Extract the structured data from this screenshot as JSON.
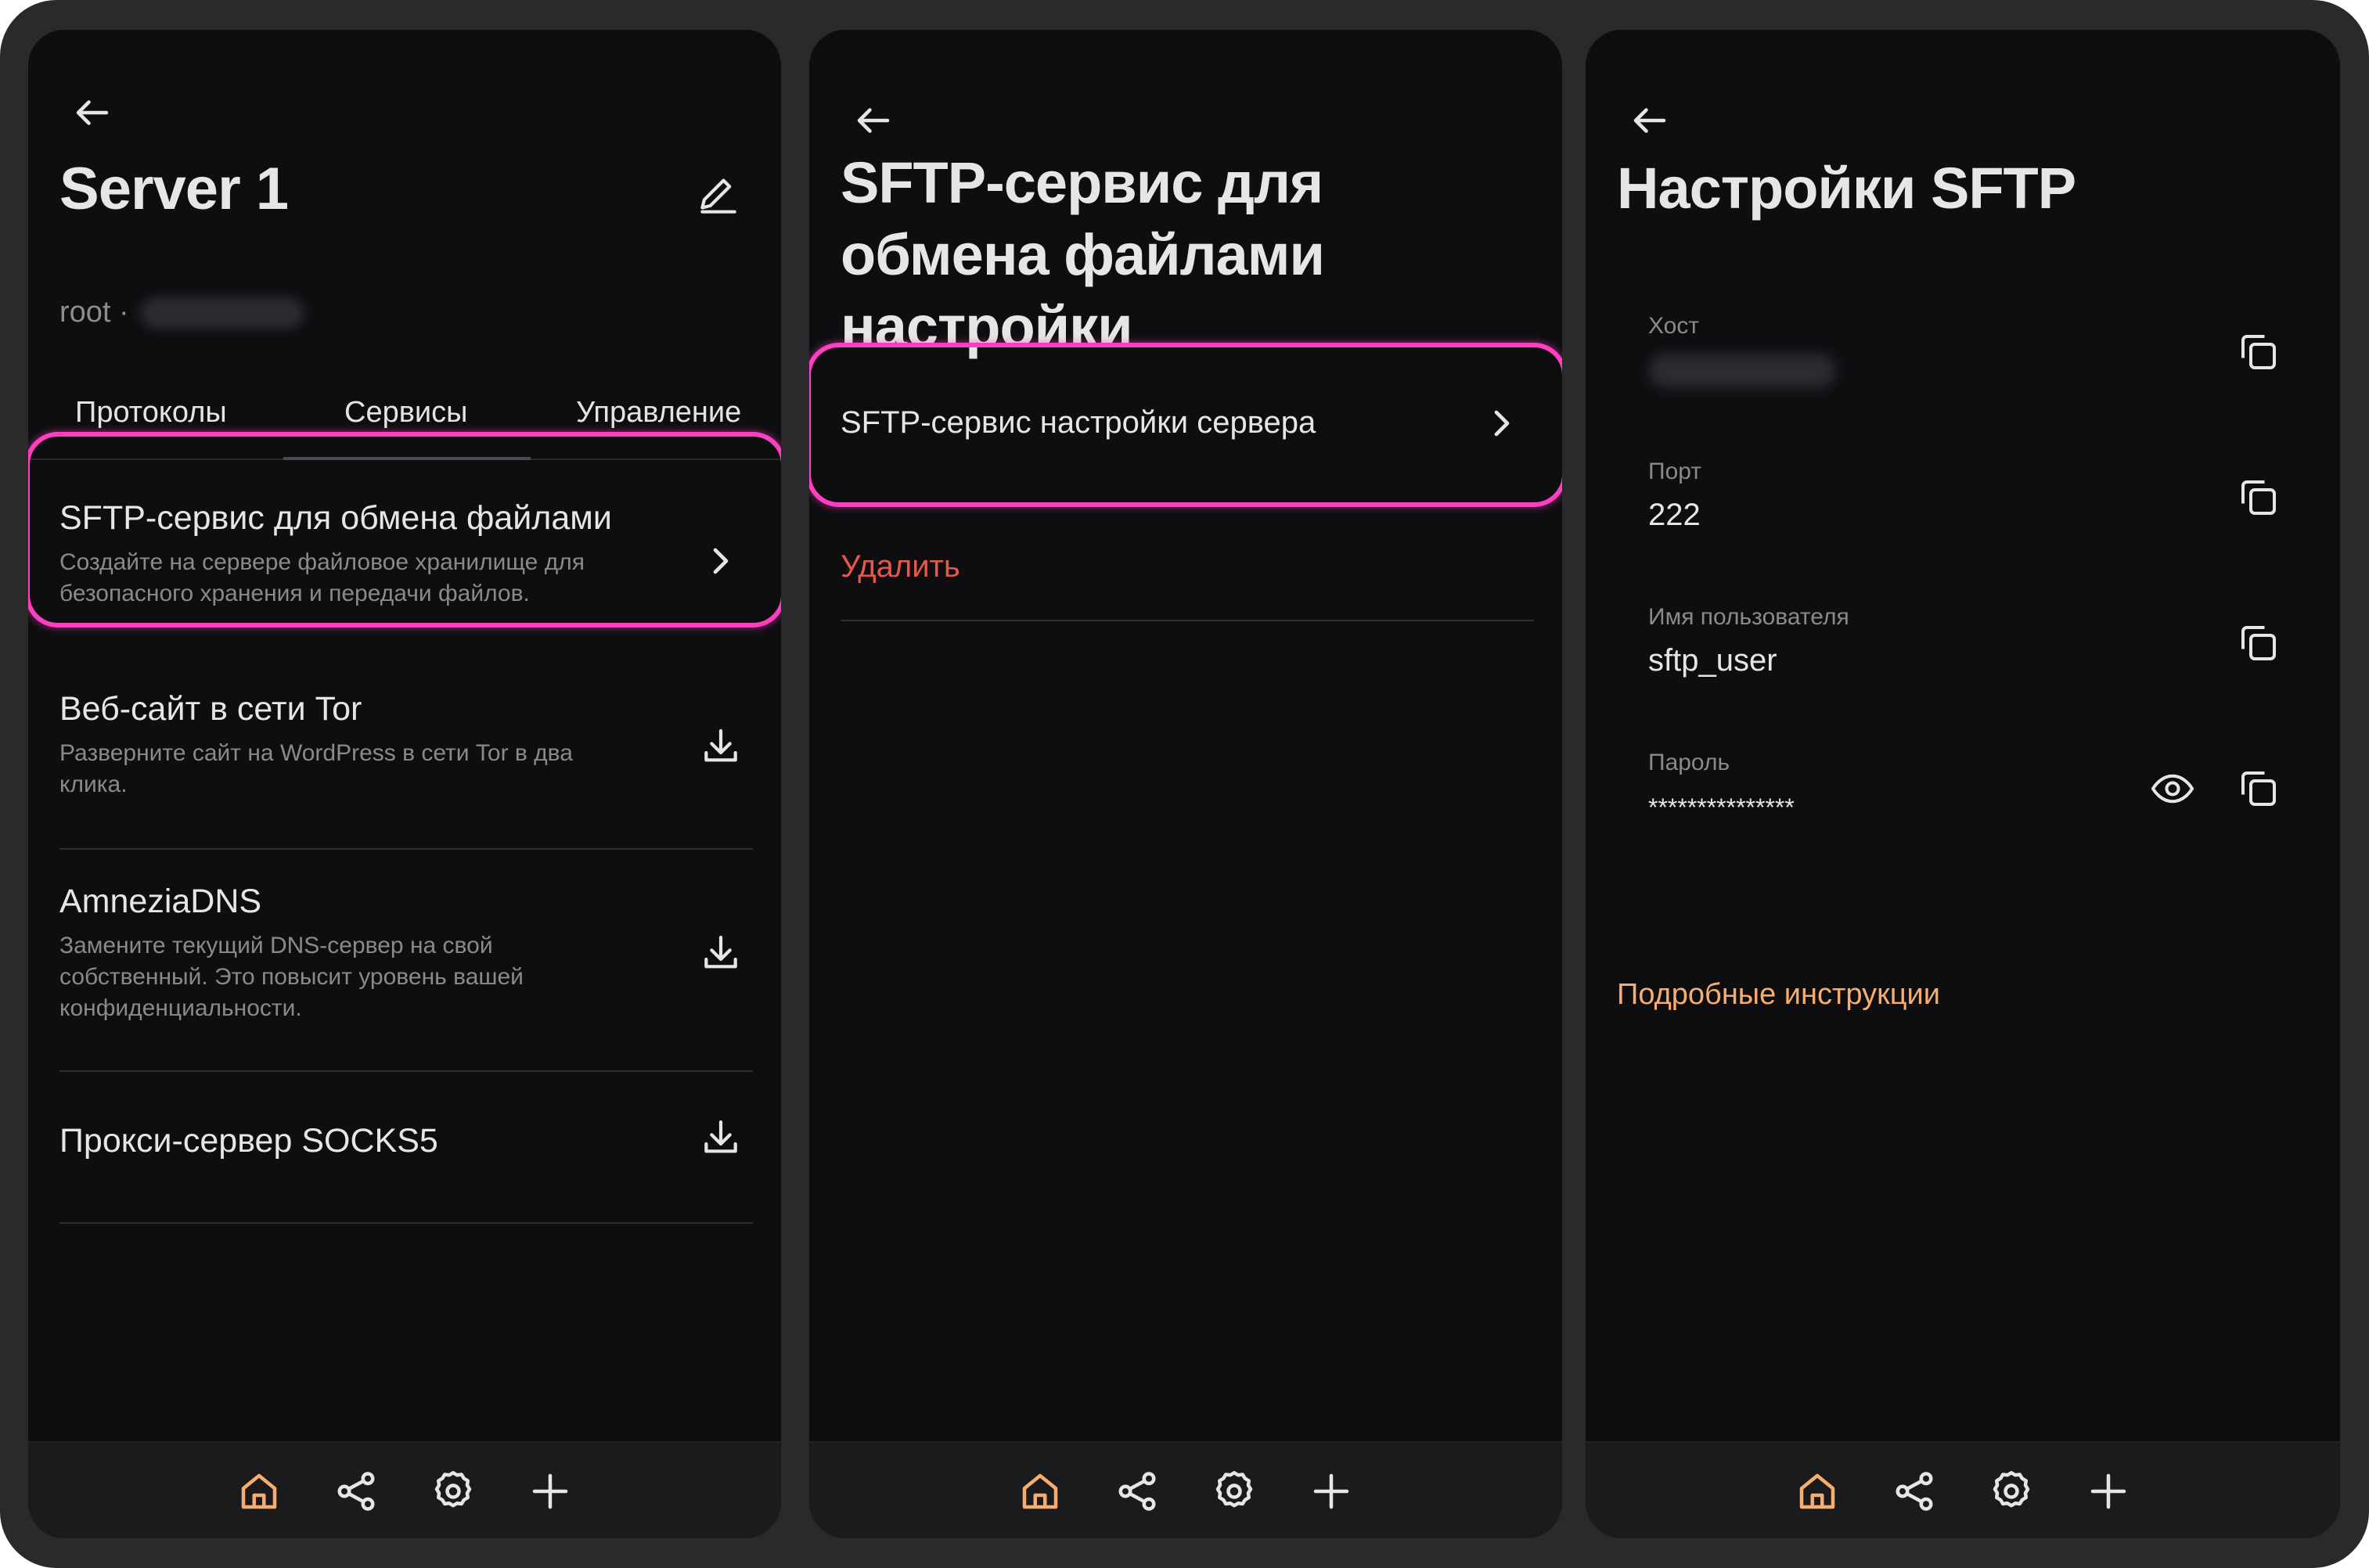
{
  "colors": {
    "accent": "#F7AD6F",
    "highlight": "#FF3FC2",
    "danger": "#E8574C",
    "background": "#0E0E11"
  },
  "screen1": {
    "title": "Server 1",
    "subtitle_user": "root ·",
    "tabs": [
      "Протоколы",
      "Сервисы",
      "Управление"
    ],
    "items": [
      {
        "name": "SFTP-сервис для обмена файлами",
        "desc": "Создайте на сервере файловое хранилище для безопасного хранения и передачи файлов.",
        "icon": "chevron-right-icon"
      },
      {
        "name": "Веб-сайт в сети Tor",
        "desc": "Разверните сайт на WordPress в сети Tor в два клика.",
        "icon": "download-icon"
      },
      {
        "name": "AmneziaDNS",
        "desc": "Замените текущий DNS-сервер на свой собственный. Это повысит уровень вашей конфиденциальности.",
        "icon": "download-icon"
      },
      {
        "name": "Прокси-сервер SOCKS5",
        "desc": "",
        "icon": "download-icon"
      }
    ]
  },
  "screen2": {
    "title": "SFTP-сервис для обмена файлами настройки",
    "item": "SFTP-сервис настройки сервера",
    "delete": "Удалить"
  },
  "screen3": {
    "title": "Настройки SFTP",
    "fields": [
      {
        "label": "Хост",
        "value": ""
      },
      {
        "label": "Порт",
        "value": "222"
      },
      {
        "label": "Имя пользователя",
        "value": "sftp_user"
      },
      {
        "label": "Пароль",
        "value": "***************"
      }
    ],
    "instructions": "Подробные инструкции"
  },
  "bottom_nav": [
    "home-icon",
    "share-icon",
    "gear-icon",
    "plus-icon"
  ]
}
